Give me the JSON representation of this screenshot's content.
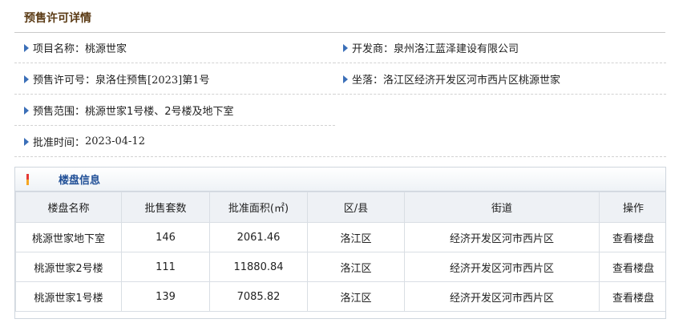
{
  "page": {
    "title": "预售许可详情"
  },
  "info": {
    "project_name": {
      "label": "项目名称：",
      "value": "桃源世家"
    },
    "developer": {
      "label": "开发商：",
      "value": "泉州洛江蓝泽建设有限公司"
    },
    "permit_no": {
      "label": "预售许可号：",
      "value": "泉洛住预售[2023]第1号"
    },
    "location": {
      "label": "坐落：",
      "value": "洛江区经济开发区河市西片区桃源世家"
    },
    "scope": {
      "label": "预售范围：",
      "value": "桃源世家1号楼、2号楼及地下室"
    },
    "approval_time": {
      "label": "批准时间：",
      "value": "2023-04-12"
    }
  },
  "panel": {
    "title": "楼盘信息",
    "columns": [
      "楼盘名称",
      "批售套数",
      "批准面积(㎡)",
      "区/县",
      "街道",
      "操作"
    ],
    "rows": [
      {
        "name": "桃源世家地下室",
        "units": "146",
        "area": "2061.46",
        "district": "洛江区",
        "street": "经济开发区河市西片区",
        "action": "查看楼盘"
      },
      {
        "name": "桃源世家2号楼",
        "units": "111",
        "area": "11880.84",
        "district": "洛江区",
        "street": "经济开发区河市西片区",
        "action": "查看楼盘"
      },
      {
        "name": "桃源世家1号楼",
        "units": "139",
        "area": "7085.82",
        "district": "洛江区",
        "street": "经济开发区河市西片区",
        "action": "查看楼盘"
      }
    ]
  },
  "colors": {
    "title": "#5a3a14",
    "accent": "#1f4e96",
    "arrow": "#3b6fb8"
  },
  "icons": {
    "row_marker": "triangle-right-icon",
    "panel_marker": "red-bar-icon"
  }
}
